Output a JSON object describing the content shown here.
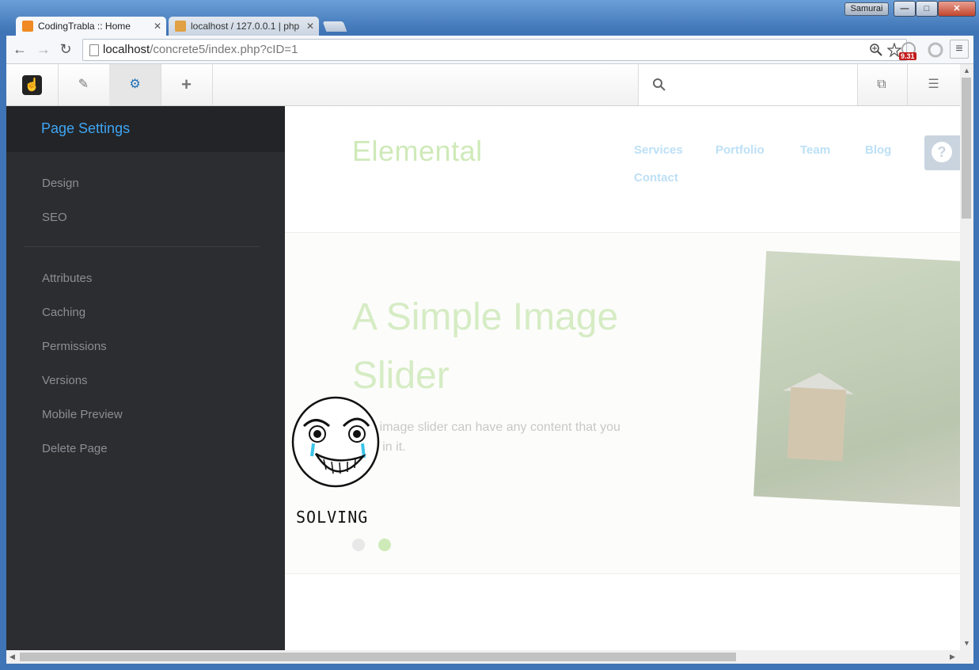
{
  "window": {
    "user_badge": "Samurai",
    "min_glyph": "—",
    "max_glyph": "□",
    "close_glyph": "✕"
  },
  "tabs": [
    {
      "label": "CodingTrabla :: Home",
      "active": true,
      "close": "✕"
    },
    {
      "label": "localhost / 127.0.0.1 | php",
      "active": false,
      "close": "✕"
    }
  ],
  "toolbar": {
    "back": "←",
    "forward": "→",
    "reload": "↻",
    "url_host": "localhost",
    "url_path": "/concrete5/index.php?cID=1",
    "extension_badge": "9.31",
    "menu": "≡"
  },
  "cms": {
    "logo": "☝",
    "edit": "✎",
    "settings": "⚙",
    "add": "+",
    "search": "🔍",
    "pages": "⧉",
    "sliders": "☰"
  },
  "panel": {
    "title": "Page Settings",
    "group1": [
      "Design",
      "SEO"
    ],
    "group2": [
      "Attributes",
      "Caching",
      "Permissions",
      "Versions",
      "Mobile Preview",
      "Delete Page"
    ]
  },
  "site": {
    "brand": "Elemental",
    "nav": [
      "Services",
      "Portfolio",
      "Team",
      "Blog",
      "Contact"
    ],
    "help": "?",
    "hero_title": "A Simple Image Slider",
    "hero_text": "This image slider can have any content that you want in it.",
    "slider_active_index": 1,
    "colors": {
      "brand": "#cfeab9",
      "nav": "#bde0f6",
      "dot_active": "#cfeab9",
      "dot_inactive": "#e8e8e8"
    }
  },
  "overlay": {
    "caption": "SOLVING"
  }
}
